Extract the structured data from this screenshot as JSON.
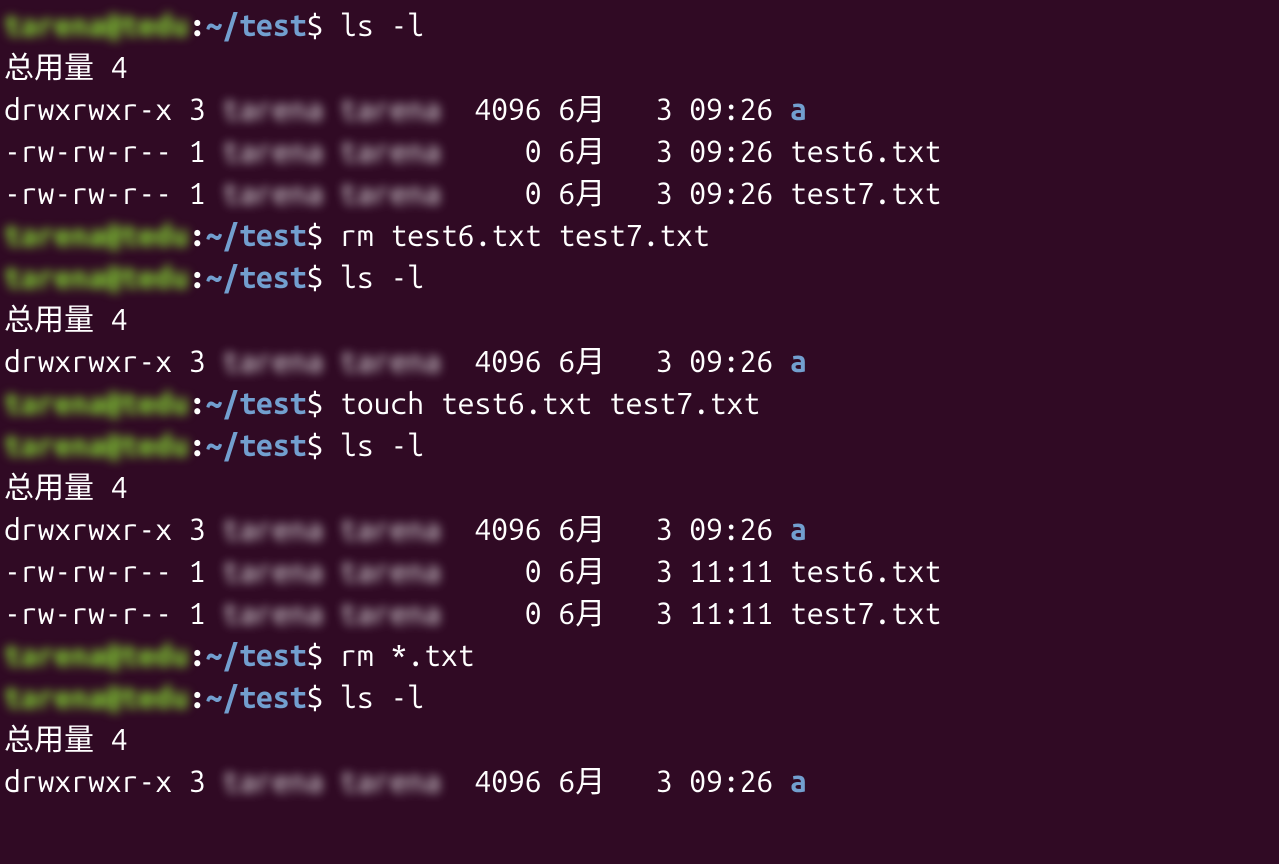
{
  "prompt": {
    "user_host_blurred": "tarena@tedu",
    "sep": ":",
    "path_tilde": "~",
    "path_dir": "/test",
    "dollar": "$"
  },
  "owner_blurred": "tarena tarena",
  "lines": [
    {
      "type": "prompt",
      "cmd": "ls -l"
    },
    {
      "type": "output",
      "text": "总用量 4"
    },
    {
      "type": "lsrow",
      "perms": "drwxrwxr-x",
      "links": "3",
      "size": " 4096",
      "date": "6月   3 09:26",
      "name": "a",
      "isdir": true
    },
    {
      "type": "lsrow",
      "perms": "-rw-rw-r--",
      "links": "1",
      "size": "    0",
      "date": "6月   3 09:26",
      "name": "test6.txt",
      "isdir": false
    },
    {
      "type": "lsrow",
      "perms": "-rw-rw-r--",
      "links": "1",
      "size": "    0",
      "date": "6月   3 09:26",
      "name": "test7.txt",
      "isdir": false
    },
    {
      "type": "prompt",
      "cmd": "rm test6.txt test7.txt"
    },
    {
      "type": "prompt",
      "cmd": "ls -l"
    },
    {
      "type": "output",
      "text": "总用量 4"
    },
    {
      "type": "lsrow",
      "perms": "drwxrwxr-x",
      "links": "3",
      "size": " 4096",
      "date": "6月   3 09:26",
      "name": "a",
      "isdir": true
    },
    {
      "type": "prompt",
      "cmd": "touch test6.txt test7.txt"
    },
    {
      "type": "prompt",
      "cmd": "ls -l"
    },
    {
      "type": "output",
      "text": "总用量 4"
    },
    {
      "type": "lsrow",
      "perms": "drwxrwxr-x",
      "links": "3",
      "size": " 4096",
      "date": "6月   3 09:26",
      "name": "a",
      "isdir": true
    },
    {
      "type": "lsrow",
      "perms": "-rw-rw-r--",
      "links": "1",
      "size": "    0",
      "date": "6月   3 11:11",
      "name": "test6.txt",
      "isdir": false
    },
    {
      "type": "lsrow",
      "perms": "-rw-rw-r--",
      "links": "1",
      "size": "    0",
      "date": "6月   3 11:11",
      "name": "test7.txt",
      "isdir": false
    },
    {
      "type": "prompt",
      "cmd": "rm *.txt"
    },
    {
      "type": "prompt",
      "cmd": "ls -l"
    },
    {
      "type": "output",
      "text": "总用量 4"
    },
    {
      "type": "lsrow",
      "perms": "drwxrwxr-x",
      "links": "3",
      "size": " 4096",
      "date": "6月   3 09:26",
      "name": "a",
      "isdir": true
    }
  ]
}
